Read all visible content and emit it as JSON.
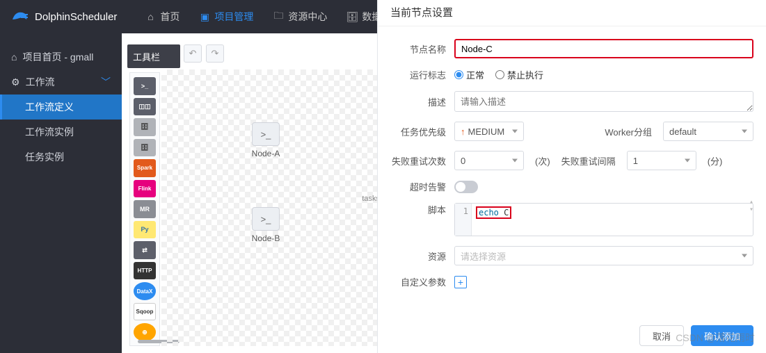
{
  "brand": "DolphinScheduler",
  "nav": {
    "home": "首页",
    "project": "项目管理",
    "resource": "资源中心",
    "datasource": "数据源"
  },
  "sidebar": {
    "projectHome": "项目首页 - gmall",
    "workflow": "工作流",
    "workflowDef": "工作流定义",
    "workflowInst": "工作流实例",
    "taskInst": "任务实例"
  },
  "toolbar": {
    "label": "工具栏"
  },
  "palette": [
    "SHELL",
    "PROC",
    "SQL",
    "Spark",
    "Flink",
    "MR",
    "Py",
    "DEP",
    "HTTP",
    "DataX",
    "Sqoop",
    "⊕"
  ],
  "canvas": {
    "nodeA": "Node-A",
    "nodeB": "Node-B",
    "tasks": "tasks"
  },
  "panel": {
    "title": "当前节点设置",
    "labels": {
      "name": "节点名称",
      "runFlag": "运行标志",
      "normal": "正常",
      "forbid": "禁止执行",
      "desc": "描述",
      "descPH": "请输入描述",
      "priority": "任务优先级",
      "priorityVal": "MEDIUM",
      "workerGroup": "Worker分组",
      "workerGroupVal": "default",
      "retryCount": "失败重试次数",
      "retryCountVal": "0",
      "retryCountUnit": "(次)",
      "retryInterval": "失败重试间隔",
      "retryIntervalVal": "1",
      "retryIntervalUnit": "(分)",
      "timeout": "超时告警",
      "script": "脚本",
      "scriptLine": "1",
      "scriptKw": "echo",
      "scriptArg": " C",
      "resource": "资源",
      "resourcePH": "请选择资源",
      "custom": "自定义参数"
    },
    "values": {
      "name": "Node-C"
    },
    "buttons": {
      "cancel": "取消",
      "ok": "确认添加"
    }
  },
  "watermark": "CSDN @落花雨时"
}
